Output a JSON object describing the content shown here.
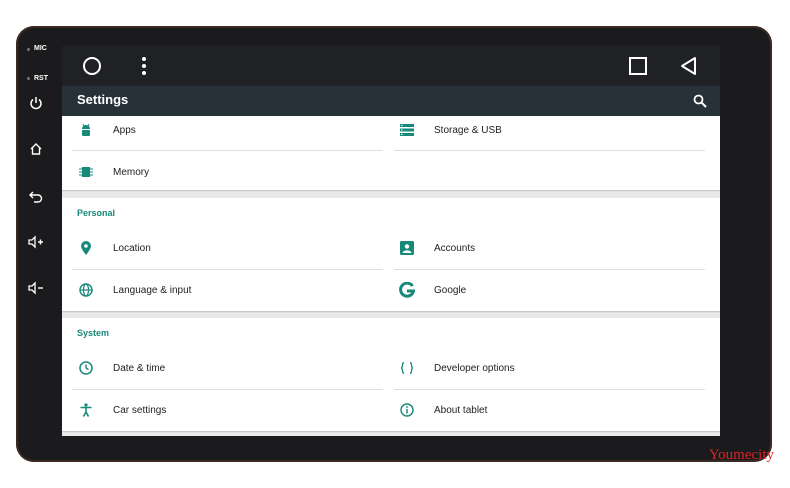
{
  "device": {
    "side_labels": {
      "mic": "MIC",
      "rst": "RST"
    },
    "side_buttons": [
      "power-icon",
      "home-icon",
      "back-icon",
      "volume-up-icon",
      "volume-down-icon"
    ]
  },
  "navbar": {
    "icons": [
      "home-circle-icon",
      "overflow-menu-icon",
      "recents-square-icon",
      "back-triangle-icon"
    ]
  },
  "appbar": {
    "title": "Settings",
    "search_icon": "search-icon"
  },
  "sections": {
    "device": {
      "items": [
        {
          "label": "Apps",
          "icon": "android-icon"
        },
        {
          "label": "Storage & USB",
          "icon": "storage-icon"
        },
        {
          "label": "Memory",
          "icon": "memory-icon"
        }
      ]
    },
    "personal": {
      "title": "Personal",
      "items": [
        {
          "label": "Location",
          "icon": "location-icon"
        },
        {
          "label": "Accounts",
          "icon": "accounts-icon"
        },
        {
          "label": "Language & input",
          "icon": "globe-icon"
        },
        {
          "label": "Google",
          "icon": "google-icon"
        }
      ]
    },
    "system": {
      "title": "System",
      "items": [
        {
          "label": "Date & time",
          "icon": "clock-icon"
        },
        {
          "label": "Developer options",
          "icon": "braces-icon"
        },
        {
          "label": "Car settings",
          "icon": "accessibility-icon"
        },
        {
          "label": "About tablet",
          "icon": "info-icon"
        }
      ]
    }
  },
  "colors": {
    "accent": "#17897b",
    "appbar": "#263238",
    "navbar": "#202124",
    "background": "#e9e9e9"
  },
  "watermark": "Youmecity"
}
